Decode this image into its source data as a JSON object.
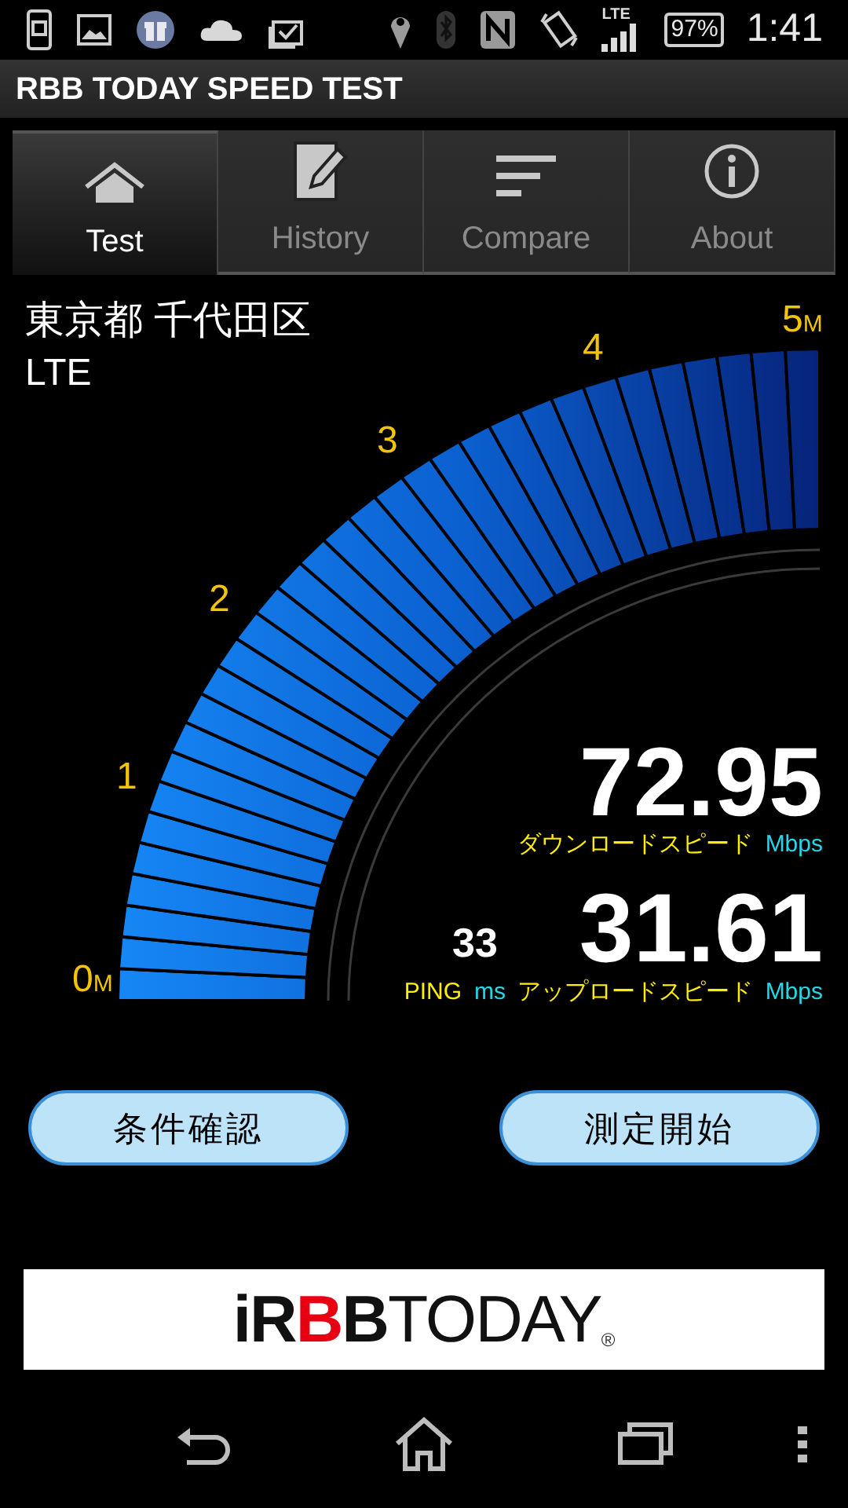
{
  "status_bar": {
    "network": "LTE",
    "battery": "97%",
    "time": "1:41"
  },
  "app_bar": {
    "title": "RBB TODAY SPEED TEST"
  },
  "tabs": [
    {
      "label": "Test",
      "selected": true
    },
    {
      "label": "History",
      "selected": false
    },
    {
      "label": "Compare",
      "selected": false
    },
    {
      "label": "About",
      "selected": false
    }
  ],
  "location": "東京都 千代田区",
  "connection": "LTE",
  "gauge": {
    "ticks": [
      {
        "value": "0",
        "unit": "M"
      },
      {
        "value": "1"
      },
      {
        "value": "2"
      },
      {
        "value": "3"
      },
      {
        "value": "4"
      },
      {
        "value": "5",
        "unit": "M"
      }
    ]
  },
  "download": {
    "value": "72.95",
    "label": "ダウンロードスピード",
    "unit": "Mbps"
  },
  "ping": {
    "value": "33",
    "label": "PING",
    "unit": "ms"
  },
  "upload": {
    "value": "31.61",
    "label": "アップロードスピード",
    "unit": "Mbps"
  },
  "buttons": [
    "条件確認",
    "測定開始"
  ],
  "banner": {
    "parts": [
      {
        "text": "iR",
        "color": "#111111",
        "kind": "bold"
      },
      {
        "text": "B",
        "color": "#e60012",
        "kind": "bold"
      },
      {
        "text": "B",
        "color": "#111111",
        "kind": "bold"
      },
      {
        "text": "TODAY",
        "color": "#111111",
        "kind": "light"
      }
    ],
    "mark": "®"
  }
}
